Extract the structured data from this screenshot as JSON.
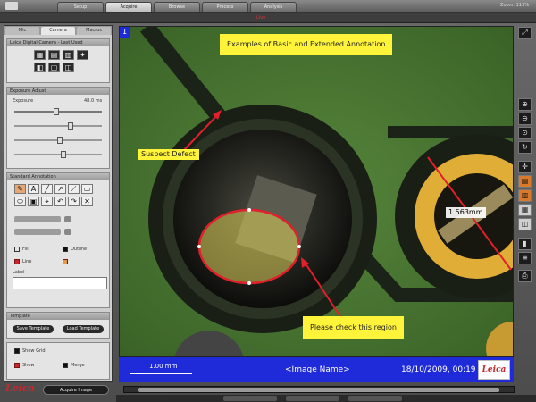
{
  "topbar": {
    "tabs": [
      "Setup",
      "Acquire",
      "Browse",
      "Process",
      "Analysis"
    ],
    "active_tab": 1,
    "right_text": "Zoom: 113%"
  },
  "subbar": {
    "live_label": "Live"
  },
  "left_panel": {
    "tabs": [
      "Mic",
      "Camera",
      "Macros"
    ],
    "active_tab": 1,
    "camera_section": {
      "title": "Leica Digital Camera - Last Used"
    },
    "exposure_section": {
      "title": "Exposure Adjust",
      "label": "Exposure",
      "value": "48.0 ms"
    },
    "annotation_section": {
      "title": "Standard Annotation",
      "tools": [
        "✎",
        "A",
        "╱",
        "↗",
        "⟋",
        "▭",
        "⬭",
        "▣",
        "⌖",
        "↶",
        "↷",
        "✕"
      ],
      "fill_label": "Fill",
      "line_label": "Line",
      "outline_label": "Outline",
      "label_label": "Label"
    },
    "template_section": {
      "title": "Template",
      "save_button": "Save Template",
      "load_button": "Load Template"
    },
    "options": {
      "show_grid": "Show Grid",
      "show": "Show",
      "merge": "Merge"
    },
    "acquire_button": "Acquire Image",
    "logo_text": "Leica"
  },
  "viewport": {
    "image_number": "1",
    "title_label": "Examples of Basic and Extended Annotation",
    "defect_label": "Suspect Defect",
    "measure_label": "1.563mm",
    "check_label": "Please check this region"
  },
  "infobar": {
    "scale_text": "1.00 mm",
    "image_name": "<Image Name>",
    "timestamp": "18/10/2009, 00:19",
    "brand": "Leica"
  },
  "colors": {
    "annotation_red": "#e0202a",
    "label_yellow": "#fff43a",
    "info_blue": "#1f2bd8",
    "ring_yellow": "#e8b43a"
  }
}
